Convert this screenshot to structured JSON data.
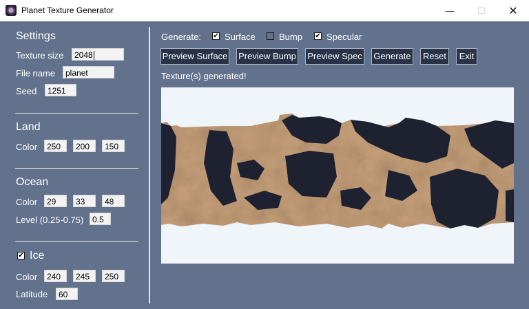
{
  "window": {
    "title": "Planet Texture Generator",
    "minimize_glyph": "—",
    "maximize_glyph": "☐",
    "close_glyph": "✕"
  },
  "settings": {
    "heading": "Settings",
    "texture_size_label": "Texture size",
    "texture_size_value": "2048",
    "file_name_label": "File name",
    "file_name_value": "planet",
    "seed_label": "Seed",
    "seed_value": "1251"
  },
  "land": {
    "heading": "Land",
    "color_label": "Color",
    "r": "250",
    "g": "200",
    "b": "150"
  },
  "ocean": {
    "heading": "Ocean",
    "color_label": "Color",
    "r": "29",
    "g": "33",
    "b": "48",
    "level_label": "Level (0.25-0.75)",
    "level_value": "0.5"
  },
  "ice": {
    "heading": "Ice",
    "checked": true,
    "color_label": "Color",
    "r": "240",
    "g": "245",
    "b": "250",
    "latitude_label": "Latitude",
    "latitude_value": "60"
  },
  "generate": {
    "label": "Generate:",
    "options": [
      {
        "label": "Surface",
        "checked": true
      },
      {
        "label": "Bump",
        "checked": false
      },
      {
        "label": "Specular",
        "checked": true
      }
    ]
  },
  "buttons": {
    "preview_surface": "Preview Surface",
    "preview_bump": "Preview Bump",
    "preview_spec": "Preview Spec",
    "generate": "Generate",
    "reset": "Reset",
    "exit": "Exit"
  },
  "status": "Texture(s) generated!",
  "colors": {
    "panel_bg": "#62728c",
    "button_bg": "#28334a",
    "land": "#fac896",
    "ocean": "#1d2130",
    "ice": "#f0f5fa"
  }
}
